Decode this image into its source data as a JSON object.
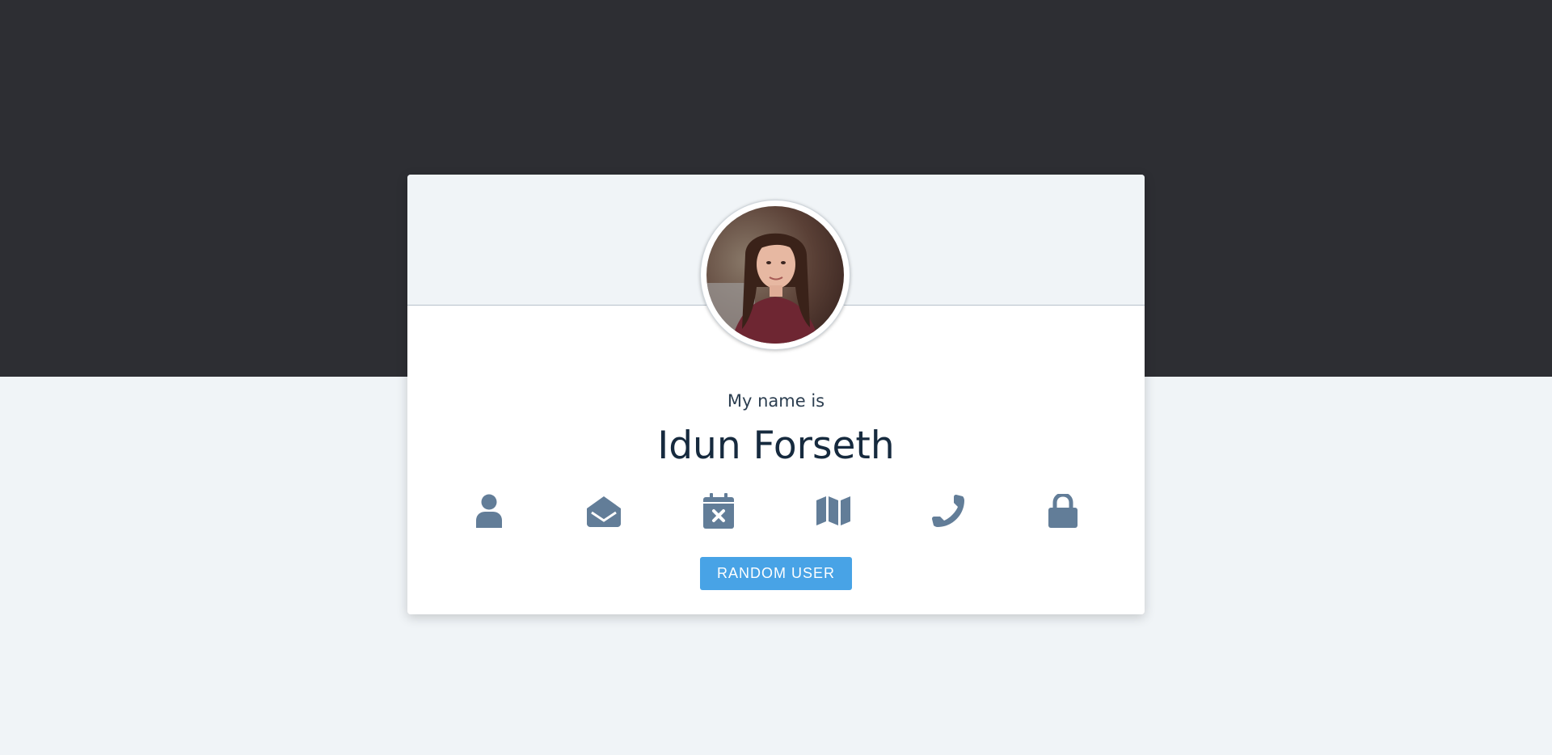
{
  "profile": {
    "label": "My name is",
    "value": "Idun Forseth"
  },
  "icons": [
    {
      "name": "user-icon"
    },
    {
      "name": "envelope-open-icon"
    },
    {
      "name": "calendar-times-icon"
    },
    {
      "name": "map-icon"
    },
    {
      "name": "phone-icon"
    },
    {
      "name": "lock-icon"
    }
  ],
  "actions": {
    "random_user_label": "Random User"
  },
  "colors": {
    "top_band": "#2d2e33",
    "background": "#f0f4f7",
    "icon": "#627d98",
    "button": "#48a3e6",
    "name_text": "#162a3e"
  }
}
